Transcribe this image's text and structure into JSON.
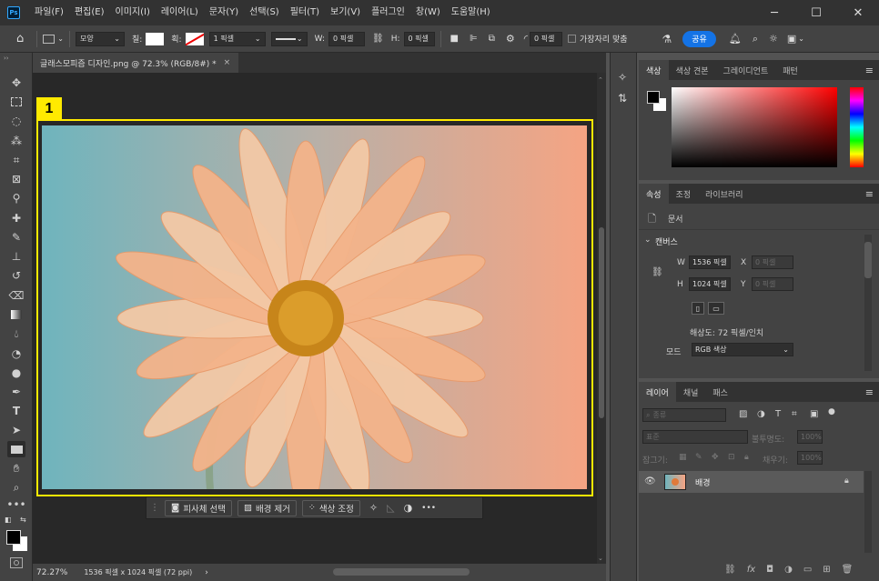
{
  "titlebar": {
    "logo": "Ps",
    "menus": [
      "파일(F)",
      "편집(E)",
      "이미지(I)",
      "레이어(L)",
      "문자(Y)",
      "선택(S)",
      "필터(T)",
      "보기(V)",
      "플러그인",
      "창(W)",
      "도움말(H)"
    ],
    "minimize": "─",
    "maximize": "☐",
    "close": "✕"
  },
  "options": {
    "shape_mode": "모양",
    "fill_label": "칠:",
    "stroke_label": "획:",
    "stroke_width": "1 픽셀",
    "w_label": "W:",
    "w_value": "0 픽셀",
    "h_label": "H:",
    "h_value": "0 픽셀",
    "radius_value": "0 픽셀",
    "align_edges": "가장자리 맞춤",
    "share": "공유"
  },
  "document": {
    "tab_title": "글래스모피즘 디자인.png @ 72.3% (RGB/8#) *",
    "tab_close": "×",
    "selection_label": "1",
    "zoom": "72.27%",
    "doc_info": "1536 픽셀 x 1024 픽셀 (72 ppi)",
    "status_arrow": "›"
  },
  "context_bar": {
    "select_subject": "피사체 선택",
    "remove_bg": "배경 제거",
    "color_adjust": "색상 조정",
    "more": "•••"
  },
  "color_panel": {
    "tabs": [
      "색상",
      "색상 견본",
      "그레이디언트",
      "패턴"
    ],
    "foreground": "#000000",
    "background": "#ffffff",
    "hue": "#ff0000"
  },
  "properties_panel": {
    "tabs": [
      "속성",
      "조정",
      "라이브러리"
    ],
    "doc_label": "문서",
    "section": "캔버스",
    "w_label": "W",
    "w_value": "1536 픽셀",
    "h_label": "H",
    "h_value": "1024 픽셀",
    "x_label": "X",
    "x_value": "0 픽셀",
    "y_label": "Y",
    "y_value": "0 픽셀",
    "resolution": "해상도: 72 픽셀/인치",
    "mode_label": "모드",
    "mode_value": "RGB 색상"
  },
  "layers_panel": {
    "tabs": [
      "레이어",
      "채널",
      "패스"
    ],
    "search": "종류",
    "blend_mode": "표준",
    "opacity_label": "불투명도:",
    "opacity_value": "100%",
    "lock_label": "잠그기:",
    "fill_label": "채우기:",
    "fill_value": "100%",
    "layer_name": "배경"
  }
}
